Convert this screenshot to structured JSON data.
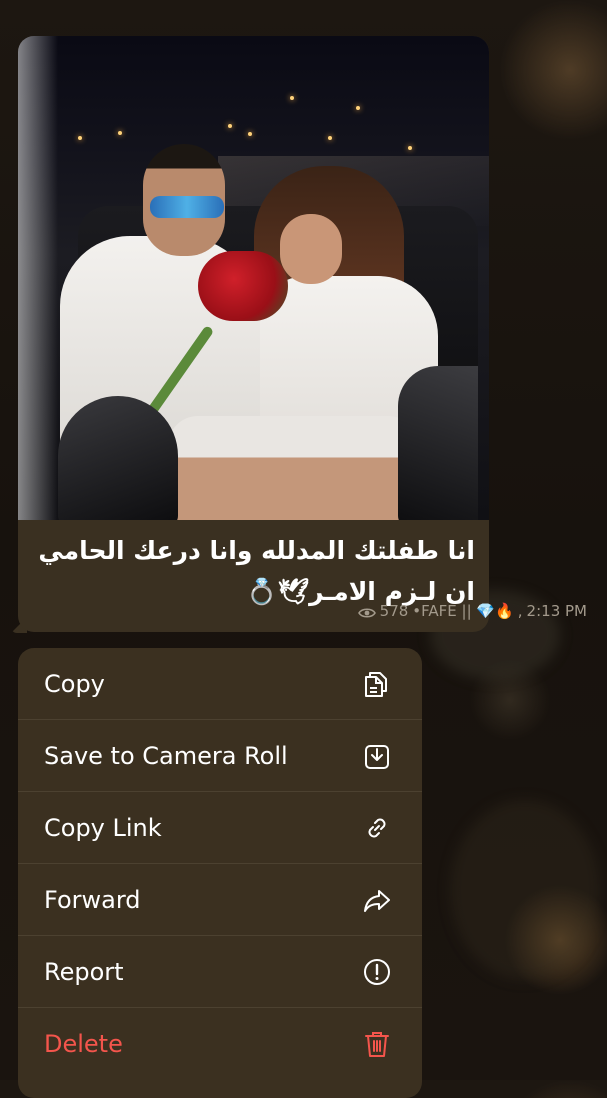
{
  "message": {
    "caption": "انا طفلتك المدلله وانا درعك الحامي ان لـزم الامـر🕊💍",
    "views": "578",
    "signature": "•FAFE || 💎🔥",
    "time": "2:13 PM"
  },
  "context_menu": {
    "items": [
      {
        "label": "Copy",
        "icon": "copy-icon"
      },
      {
        "label": "Save to Camera Roll",
        "icon": "download-icon"
      },
      {
        "label": "Copy Link",
        "icon": "link-icon"
      },
      {
        "label": "Forward",
        "icon": "forward-icon"
      },
      {
        "label": "Report",
        "icon": "exclamation-circle-icon"
      },
      {
        "label": "Delete",
        "icon": "trash-icon",
        "destructive": true
      }
    ]
  },
  "colors": {
    "bubble": "#3a3021",
    "menu": "#3b3020",
    "destructive": "#f4554c",
    "meta_text": "#a39a8c"
  }
}
